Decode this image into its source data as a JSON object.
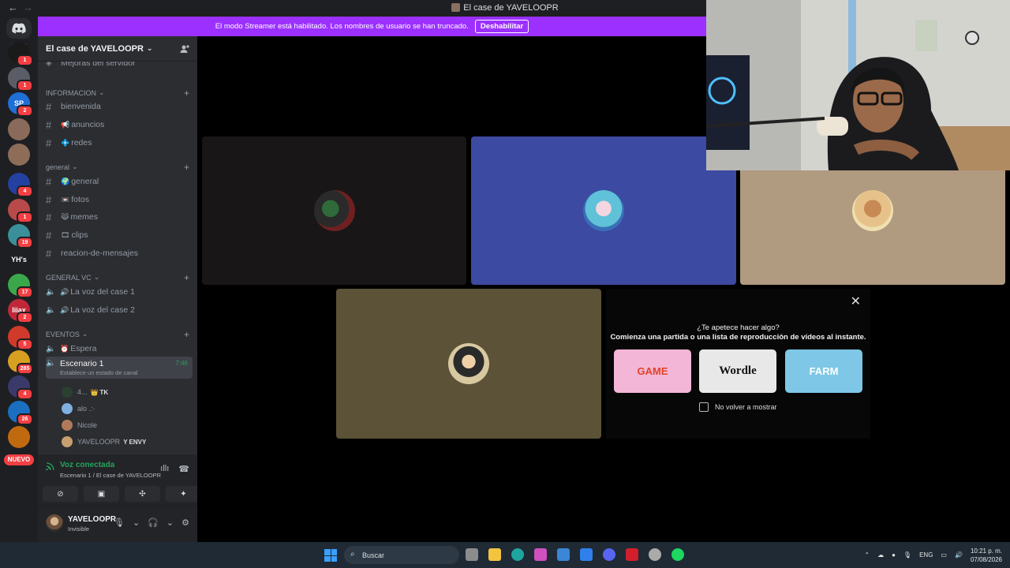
{
  "window": {
    "title": "El case de YAVELOOPR",
    "back": "←",
    "forward": "→"
  },
  "banner": {
    "text": "El modo Streamer está habilitado. Los nombres de usuario se han truncado.",
    "button": "Deshabilitar"
  },
  "rail": {
    "servers": [
      {
        "label": "",
        "badge": "1",
        "color": "#1a1a1a"
      },
      {
        "label": "",
        "badge": "1",
        "color": "#5a5d66"
      },
      {
        "label": "SP",
        "badge": "2",
        "color": "#1f6fd6"
      },
      {
        "label": "",
        "badge": "",
        "color": "#8a6a5a"
      },
      {
        "label": "",
        "badge": "",
        "color": "#8d6d58"
      },
      {
        "label": "",
        "badge": "4",
        "color": "#2440a0"
      },
      {
        "label": "",
        "badge": "1",
        "color": "#b84a4a"
      },
      {
        "label": "",
        "badge": "19",
        "color": "#3a8f9a"
      },
      {
        "label": "YH's",
        "badge": "",
        "color": "#1e1f22"
      },
      {
        "label": "",
        "badge": "17",
        "color": "#3aa84a"
      },
      {
        "label": "liiax",
        "badge": "2",
        "color": "#c0283a"
      },
      {
        "label": "",
        "badge": "5",
        "color": "#d03a2a"
      },
      {
        "label": "",
        "badge": "285",
        "color": "#d8a020"
      },
      {
        "label": "",
        "badge": "4",
        "color": "#3a3a6a"
      },
      {
        "label": "",
        "badge": "26",
        "color": "#1a6fc0"
      },
      {
        "label": "",
        "badge": "",
        "color": "#c06a10"
      }
    ],
    "nuevo": "NUEVO"
  },
  "sidebar": {
    "guild_name": "El case de YAVELOOPR",
    "partial_item": "Mejoras del servidor",
    "categories": [
      {
        "name": "INFORMACION",
        "channels": [
          {
            "name": "bienvenida",
            "emoji": ""
          },
          {
            "name": "anuncios",
            "emoji": "📢"
          },
          {
            "name": "redes",
            "emoji": "💠"
          }
        ]
      },
      {
        "name": "general",
        "channels": [
          {
            "name": "general",
            "emoji": "🌍"
          },
          {
            "name": "fotos",
            "emoji": "📼"
          },
          {
            "name": "memes",
            "emoji": "😹"
          },
          {
            "name": "clips",
            "emoji": "🎞"
          },
          {
            "name": "reacion-de-mensajes",
            "emoji": ""
          }
        ]
      },
      {
        "name": "GENERAL VC",
        "channels": [
          {
            "name": "La voz del case 1",
            "emoji": "🔊"
          },
          {
            "name": "La voz del case 2",
            "emoji": "🔊"
          }
        ]
      },
      {
        "name": "EVENTOS",
        "channels": [
          {
            "name": "Espera",
            "emoji": "⏰"
          }
        ]
      }
    ],
    "active_channel": {
      "name": "Escenario 1",
      "time": "7:46",
      "status": "Establece un estado de canal"
    },
    "members": [
      {
        "name": "4...",
        "tag": "TK",
        "tag_emoji": "👑"
      },
      {
        "name": "alo .:·",
        "tag": "",
        "tag_emoji": ""
      },
      {
        "name": "Nicole",
        "tag": "",
        "tag_emoji": ""
      },
      {
        "name": "YAVELOOPR",
        "tag": "ENVY",
        "tag_emoji": "Y"
      }
    ]
  },
  "voice_panel": {
    "status": "Voz conectada",
    "location": "Escenario 1 / El case de YAVELOOPR"
  },
  "user_panel": {
    "name": "YAVELOOPR",
    "status": "Invisible"
  },
  "stage": {
    "tiles": [
      {
        "bg": "#181616"
      },
      {
        "bg": "#3d4aa1"
      },
      {
        "bg": "#b09a80"
      },
      {
        "bg": "#5b5237"
      }
    ],
    "activity": {
      "close": "✕",
      "line1": "¿Te apetece hacer algo?",
      "line2": "Comienza una partida o una lista de reproducción de vídeos al instante.",
      "games": [
        {
          "label": "GAME",
          "bg": "#f3b6d6",
          "color": "#e0432a"
        },
        {
          "label": "Wordle",
          "bg": "#e8e8e8",
          "color": "#111111"
        },
        {
          "label": "FARM",
          "bg": "#7fc7e6",
          "color": "#ffffff"
        }
      ],
      "checkbox_label": "No volver a mostrar"
    }
  },
  "taskbar": {
    "search": "Buscar",
    "lang": "ENG",
    "time": "10:21 p. m.",
    "date": "07/08/2026"
  }
}
